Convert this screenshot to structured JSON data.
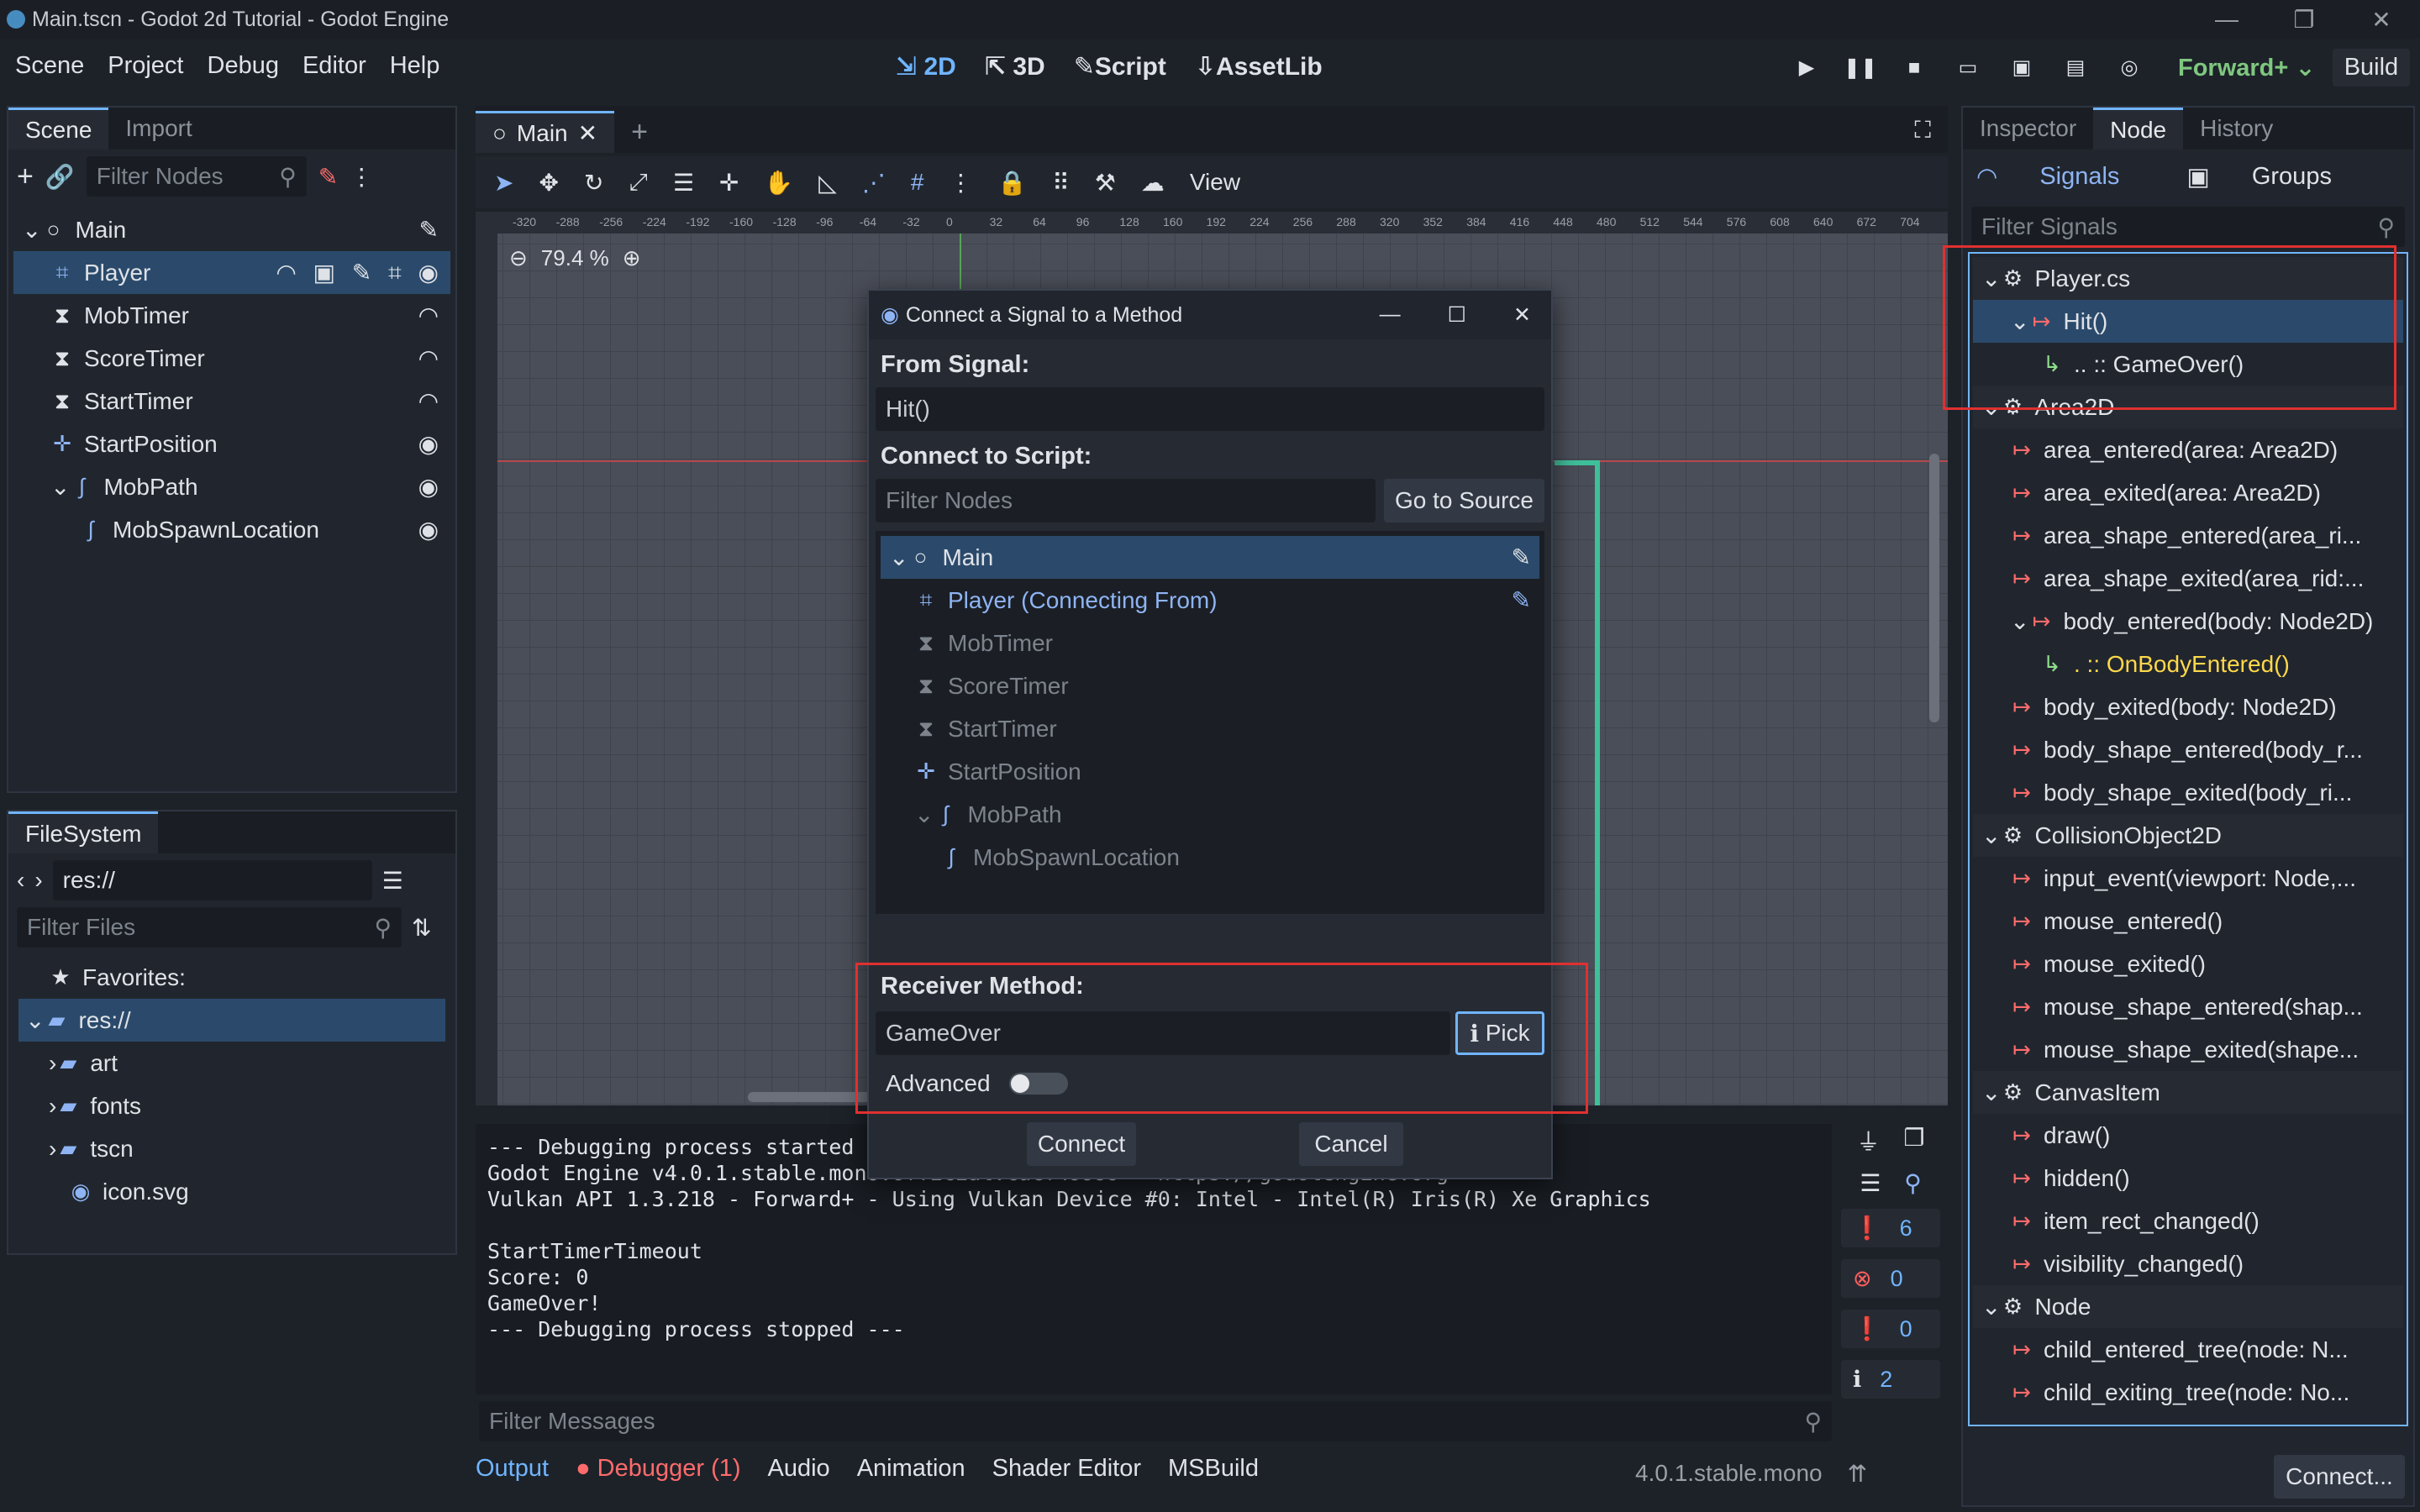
{
  "window": {
    "title": "Main.tscn - Godot 2d Tutorial - Godot Engine"
  },
  "menu": [
    "Scene",
    "Project",
    "Debug",
    "Editor",
    "Help"
  ],
  "main_modes": [
    "2D",
    "3D",
    "Script",
    "AssetLib"
  ],
  "renderer": "Forward+",
  "build": "Build",
  "scene_dock": {
    "tabs": [
      "Scene",
      "Import"
    ],
    "filter_placeholder": "Filter Nodes",
    "nodes": [
      {
        "label": "Main",
        "depth": 0
      },
      {
        "label": "Player",
        "depth": 1
      },
      {
        "label": "MobTimer",
        "depth": 1
      },
      {
        "label": "ScoreTimer",
        "depth": 1
      },
      {
        "label": "StartTimer",
        "depth": 1
      },
      {
        "label": "StartPosition",
        "depth": 1
      },
      {
        "label": "MobPath",
        "depth": 1
      },
      {
        "label": "MobSpawnLocation",
        "depth": 2
      }
    ]
  },
  "filesystem": {
    "tab": "FileSystem",
    "path": "res://",
    "filter_placeholder": "Filter Files",
    "favorites": "Favorites:",
    "root": "res://",
    "items": [
      "art",
      "fonts",
      "tscn",
      "icon.svg"
    ]
  },
  "editor_tab": "Main",
  "zoom": "79.4 %",
  "view_menu": "View",
  "ruler_labels": [
    "-320",
    "-288",
    "-256",
    "-224",
    "-192",
    "-160",
    "-128",
    "-96",
    "-64",
    "-32",
    "0",
    "32",
    "64",
    "96",
    "128",
    "160",
    "192",
    "224",
    "256",
    "288",
    "320",
    "352",
    "384",
    "416",
    "448",
    "480",
    "512",
    "544",
    "576",
    "608",
    "640",
    "672",
    "704"
  ],
  "dialog": {
    "title": "Connect a Signal to a Method",
    "from_signal_label": "From Signal:",
    "from_signal": "Hit()",
    "connect_script_label": "Connect to Script:",
    "filter_placeholder": "Filter Nodes",
    "go_to_source": "Go to Source",
    "nodes": [
      {
        "label": "Main",
        "depth": 0
      },
      {
        "label": "Player (Connecting From)",
        "depth": 1
      },
      {
        "label": "MobTimer",
        "depth": 1
      },
      {
        "label": "ScoreTimer",
        "depth": 1
      },
      {
        "label": "StartTimer",
        "depth": 1
      },
      {
        "label": "StartPosition",
        "depth": 1
      },
      {
        "label": "MobPath",
        "depth": 1
      },
      {
        "label": "MobSpawnLocation",
        "depth": 2
      }
    ],
    "receiver_label": "Receiver Method:",
    "receiver": "GameOver",
    "pick": "Pick",
    "advanced": "Advanced",
    "connect": "Connect",
    "cancel": "Cancel"
  },
  "console": {
    "lines": [
      "--- Debugging process started ---",
      "Godot Engine v4.0.1.stable.mono.official.cacf49999 - https://godotengine.org",
      "Vulkan API 1.3.218 - Forward+ - Using Vulkan Device #0: Intel - Intel(R) Iris(R) Xe Graphics",
      "",
      "StartTimerTimeout",
      "Score: 0",
      "GameOver!",
      "--- Debugging process stopped ---"
    ],
    "filter_placeholder": "Filter Messages",
    "counts": {
      "errors_badge": "6",
      "errors": "0",
      "warnings": "0",
      "messages": "2"
    }
  },
  "bottom_tabs": [
    "Output",
    "Debugger (1)",
    "Audio",
    "Animation",
    "Shader Editor",
    "MSBuild"
  ],
  "version": "4.0.1.stable.mono",
  "right_dock": {
    "tabs": [
      "Inspector",
      "Node",
      "History"
    ],
    "subtabs": [
      "Signals",
      "Groups"
    ],
    "filter_placeholder": "Filter Signals",
    "signals": [
      {
        "t": "class",
        "label": "Player.cs"
      },
      {
        "t": "sig",
        "label": "Hit()",
        "sel": true
      },
      {
        "t": "conn",
        "label": ".. :: GameOver()"
      },
      {
        "t": "class",
        "label": "Area2D"
      },
      {
        "t": "sig",
        "label": "area_entered(area: Area2D)"
      },
      {
        "t": "sig",
        "label": "area_exited(area: Area2D)"
      },
      {
        "t": "sig",
        "label": "area_shape_entered(area_ri..."
      },
      {
        "t": "sig",
        "label": "area_shape_exited(area_rid:..."
      },
      {
        "t": "sig",
        "label": "body_entered(body: Node2D)"
      },
      {
        "t": "conn2",
        "label": ". :: OnBodyEntered()"
      },
      {
        "t": "sig",
        "label": "body_exited(body: Node2D)"
      },
      {
        "t": "sig",
        "label": "body_shape_entered(body_r..."
      },
      {
        "t": "sig",
        "label": "body_shape_exited(body_ri..."
      },
      {
        "t": "class",
        "label": "CollisionObject2D"
      },
      {
        "t": "sig",
        "label": "input_event(viewport: Node,..."
      },
      {
        "t": "sig",
        "label": "mouse_entered()"
      },
      {
        "t": "sig",
        "label": "mouse_exited()"
      },
      {
        "t": "sig",
        "label": "mouse_shape_entered(shap..."
      },
      {
        "t": "sig",
        "label": "mouse_shape_exited(shape..."
      },
      {
        "t": "class",
        "label": "CanvasItem"
      },
      {
        "t": "sig",
        "label": "draw()"
      },
      {
        "t": "sig",
        "label": "hidden()"
      },
      {
        "t": "sig",
        "label": "item_rect_changed()"
      },
      {
        "t": "sig",
        "label": "visibility_changed()"
      },
      {
        "t": "class",
        "label": "Node"
      },
      {
        "t": "sig",
        "label": "child_entered_tree(node: N..."
      },
      {
        "t": "sig",
        "label": "child_exiting_tree(node: No..."
      }
    ],
    "connect_btn": "Connect..."
  }
}
